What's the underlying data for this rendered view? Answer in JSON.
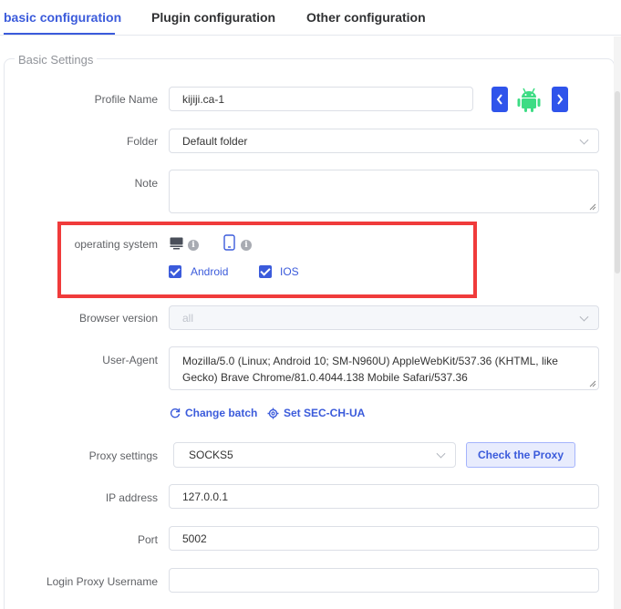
{
  "tabs": [
    {
      "label": "basic configuration"
    },
    {
      "label": "Plugin configuration"
    },
    {
      "label": "Other configuration"
    }
  ],
  "section": {
    "title": "Basic Settings"
  },
  "profile_name": {
    "label": "Profile Name",
    "value": "kijiji.ca-1"
  },
  "folder": {
    "label": "Folder",
    "value": "Default folder"
  },
  "note": {
    "label": "Note",
    "value": ""
  },
  "os": {
    "label": "operating system",
    "options": [
      {
        "label": "Android",
        "checked": true
      },
      {
        "label": "IOS",
        "checked": true
      }
    ],
    "highlight_color": "#f03b3b"
  },
  "browser_version": {
    "label": "Browser version",
    "placeholder": "all"
  },
  "user_agent": {
    "label": "User-Agent",
    "value": "Mozilla/5.0 (Linux; Android 10; SM-N960U) AppleWebKit/537.36 (KHTML, like Gecko) Brave Chrome/81.0.4044.138 Mobile Safari/537.36"
  },
  "actions": {
    "change_batch": "Change batch",
    "set_sec_ch_ua": "Set SEC-CH-UA"
  },
  "proxy": {
    "label": "Proxy settings",
    "value": "SOCKS5",
    "check_button": "Check the Proxy"
  },
  "ip": {
    "label": "IP address",
    "value": "127.0.0.1"
  },
  "port": {
    "label": "Port",
    "value": "5002"
  },
  "login_user": {
    "label": "Login Proxy Username",
    "value": ""
  },
  "colors": {
    "accent": "#3b5bdb",
    "android_green": "#3ddc84"
  }
}
